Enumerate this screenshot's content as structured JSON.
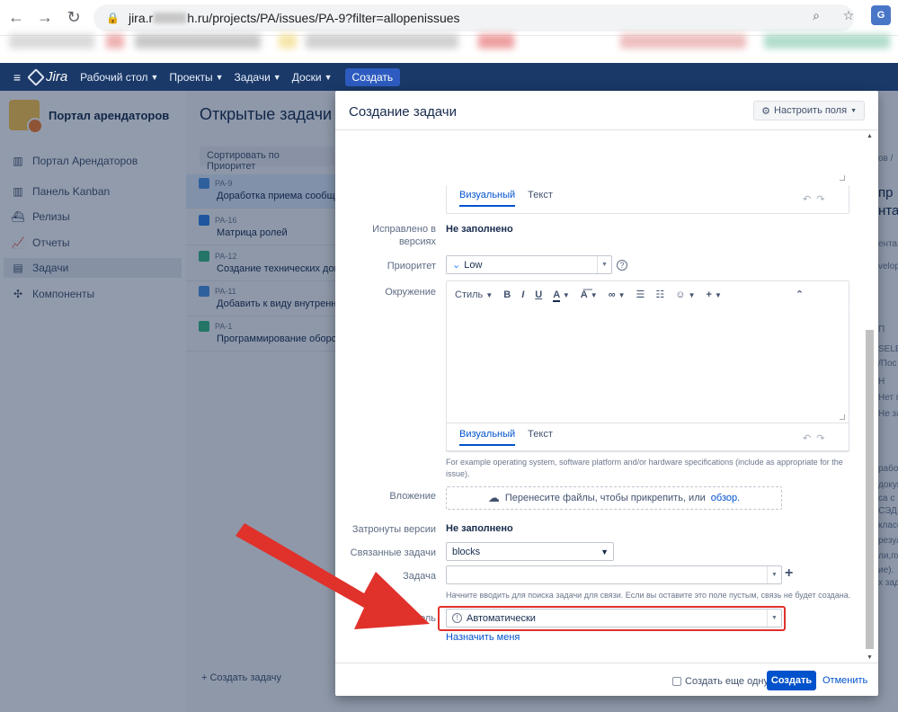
{
  "browser": {
    "url_prefix": "jira.r",
    "url_suffix": "h.ru/projects/PA/issues/PA-9?filter=allopenissues",
    "ext_label": "G"
  },
  "nav": {
    "items": [
      "Рабочий стол",
      "Проекты",
      "Задачи",
      "Доски"
    ],
    "create": "Создать",
    "logo": "Jira"
  },
  "sidebar": {
    "project": "Портал арендаторов",
    "items": [
      "Портал Арендаторов",
      "Панель Kanban",
      "Релизы",
      "Отчеты",
      "Задачи",
      "Компоненты"
    ]
  },
  "issues": {
    "title": "Открытые задачи",
    "sort": "Сортировать по Приоритет",
    "list": [
      {
        "key": "PA-9",
        "summary": "Доработка приема сообще",
        "color": "#4a8fe0"
      },
      {
        "key": "PA-16",
        "summary": "Матрица ролей",
        "color": "#2f7de1"
      },
      {
        "key": "PA-12",
        "summary": "Создание технических дог",
        "color": "#36b37e"
      },
      {
        "key": "PA-11",
        "summary": "Добавить к виду внутренне",
        "color": "#4a8fe0"
      },
      {
        "key": "PA-1",
        "summary": "Программирование оборот",
        "color": "#36b37e"
      }
    ],
    "create": "Создать задачу"
  },
  "right_strip": [
    "ов /",
    "пр",
    "нта",
    "ента",
    "velop",
    "П",
    "SELE",
    "/Пос",
    "Н",
    "Нет п",
    "Не за",
    "работ",
    "докум",
    "са с",
    "СЭД",
    "класс",
    "резул",
    "ли,пх",
    "ие).",
    "х зад"
  ],
  "dialog": {
    "title": "Создание задачи",
    "configure": "Настроить поля",
    "editor_tabs": {
      "visual": "Визуальный",
      "text": "Текст"
    },
    "fix_versions": {
      "label_1": "Исправлено в",
      "label_2": "версиях",
      "value": "Не заполнено"
    },
    "priority": {
      "label": "Приоритет",
      "value": "Low"
    },
    "environment": {
      "label": "Окружение",
      "toolbar": {
        "style": "Стиль"
      },
      "hint": "For example operating system, software platform and/or hardware specifications (include as appropriate for the issue)."
    },
    "attachment": {
      "label": "Вложение",
      "text": "Перенесите файлы, чтобы прикрепить, или",
      "link": "обзор."
    },
    "affects": {
      "label": "Затронуты версии",
      "value": "Не заполнено"
    },
    "linked": {
      "label": "Связанные задачи",
      "value": "blocks"
    },
    "task": {
      "label": "Задача",
      "hint": "Начните вводить для поиска задачи для связи. Если вы оставите это поле пустым, связь не будет создана."
    },
    "assignee": {
      "label": "Исполнитель",
      "value": "Автоматически",
      "assign_me": "Назначить меня"
    },
    "footer": {
      "create_another": "Создать еще одну",
      "create": "Создать",
      "cancel": "Отменить"
    }
  },
  "colors": {
    "jira_nav": "#1a3968",
    "primary": "#0052cc",
    "annotation": "#e0312b"
  }
}
